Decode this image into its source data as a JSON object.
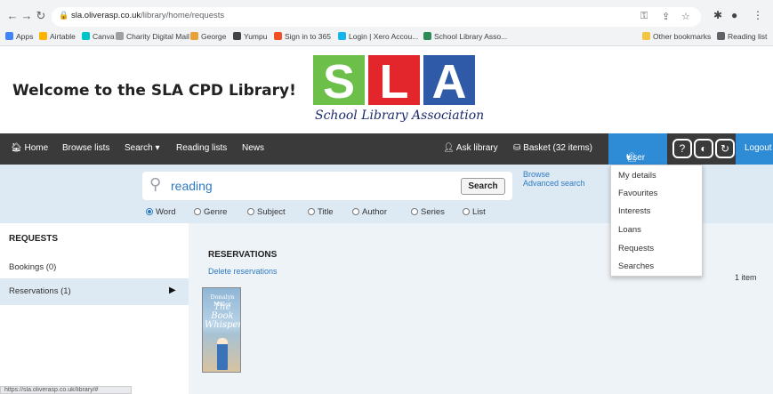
{
  "browser": {
    "url_domain": "sla.oliverasp.co.uk",
    "url_path": "/library/home/requests",
    "bookmarks": [
      {
        "label": "Apps",
        "color": "#4285f4"
      },
      {
        "label": "Airtable",
        "color": "#fcb400"
      },
      {
        "label": "Canva",
        "color": "#00c4cc"
      },
      {
        "label": "Charity Digital Mail",
        "color": "#a0a0a0"
      },
      {
        "label": "George",
        "color": "#e8a23a"
      },
      {
        "label": "Yumpu",
        "color": "#444444"
      },
      {
        "label": "Sign in to 365",
        "color": "#f25022"
      },
      {
        "label": "Login | Xero Accou...",
        "color": "#13b5ea"
      },
      {
        "label": "School Library Asso...",
        "color": "#2e8b57"
      }
    ],
    "other_bookmarks": "Other bookmarks",
    "reading_list": "Reading list"
  },
  "header": {
    "welcome": "Welcome to the SLA CPD Library!",
    "logo_letters": [
      "S",
      "L",
      "A"
    ],
    "logo_colors": [
      "#6cc04a",
      "#e2262c",
      "#2e5aa7"
    ],
    "logo_subtitle": "School Library Association"
  },
  "nav": {
    "home": "Home",
    "browse_lists": "Browse lists",
    "search": "Search",
    "reading_lists": "Reading lists",
    "news": "News",
    "ask_library": "Ask library",
    "basket": "Basket (32 items)",
    "user": "User",
    "logout": "Logout"
  },
  "search": {
    "query": "reading",
    "button": "Search",
    "browse": "Browse",
    "advanced": "Advanced search",
    "options": [
      "Word",
      "Genre",
      "Subject",
      "Title",
      "Author",
      "Series",
      "List"
    ],
    "selected": "Word"
  },
  "sidebar": {
    "title": "REQUESTS",
    "bookings": "Bookings (0)",
    "reservations": "Reservations (1)"
  },
  "main": {
    "title": "RESERVATIONS",
    "delete_link": "Delete reservations",
    "count": "1 item",
    "book": {
      "author": "Donalyn Miller",
      "title": "The Book Whisperer"
    }
  },
  "user_menu": [
    "My details",
    "Favourites",
    "Interests",
    "Loans",
    "Requests",
    "Searches"
  ],
  "status_bar": "https://sla.oliverasp.co.uk/library/#"
}
